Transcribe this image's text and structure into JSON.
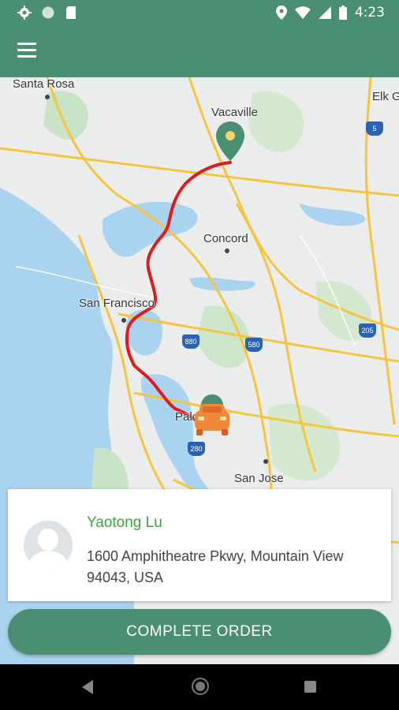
{
  "status_bar": {
    "time": "4:23",
    "left_icons": [
      "gear-icon",
      "circle-icon",
      "sd-card-icon"
    ],
    "right_icons": [
      "location-icon",
      "wifi-icon",
      "signal-icon",
      "battery-icon"
    ]
  },
  "app_bar": {
    "menu_icon": "hamburger-menu-icon"
  },
  "map": {
    "cities": [
      "Santa Rosa",
      "Vacaville",
      "Elk G",
      "Concord",
      "San Francisco",
      "Palo",
      "San Jose"
    ],
    "highway_shields": [
      "5",
      "880",
      "580",
      "205",
      "280"
    ],
    "route_color": "#e01b1b",
    "destination_pin_color": "#4a8f72",
    "vehicle_color": "#f0883a"
  },
  "order": {
    "customer_name": "Yaotong Lu",
    "address": "1600 Amphitheatre Pkwy, Mountain View\n94043, USA"
  },
  "actions": {
    "complete_label": "COMPLETE ORDER"
  },
  "colors": {
    "primary": "#4a8f72",
    "name_green": "#3aa83f"
  }
}
